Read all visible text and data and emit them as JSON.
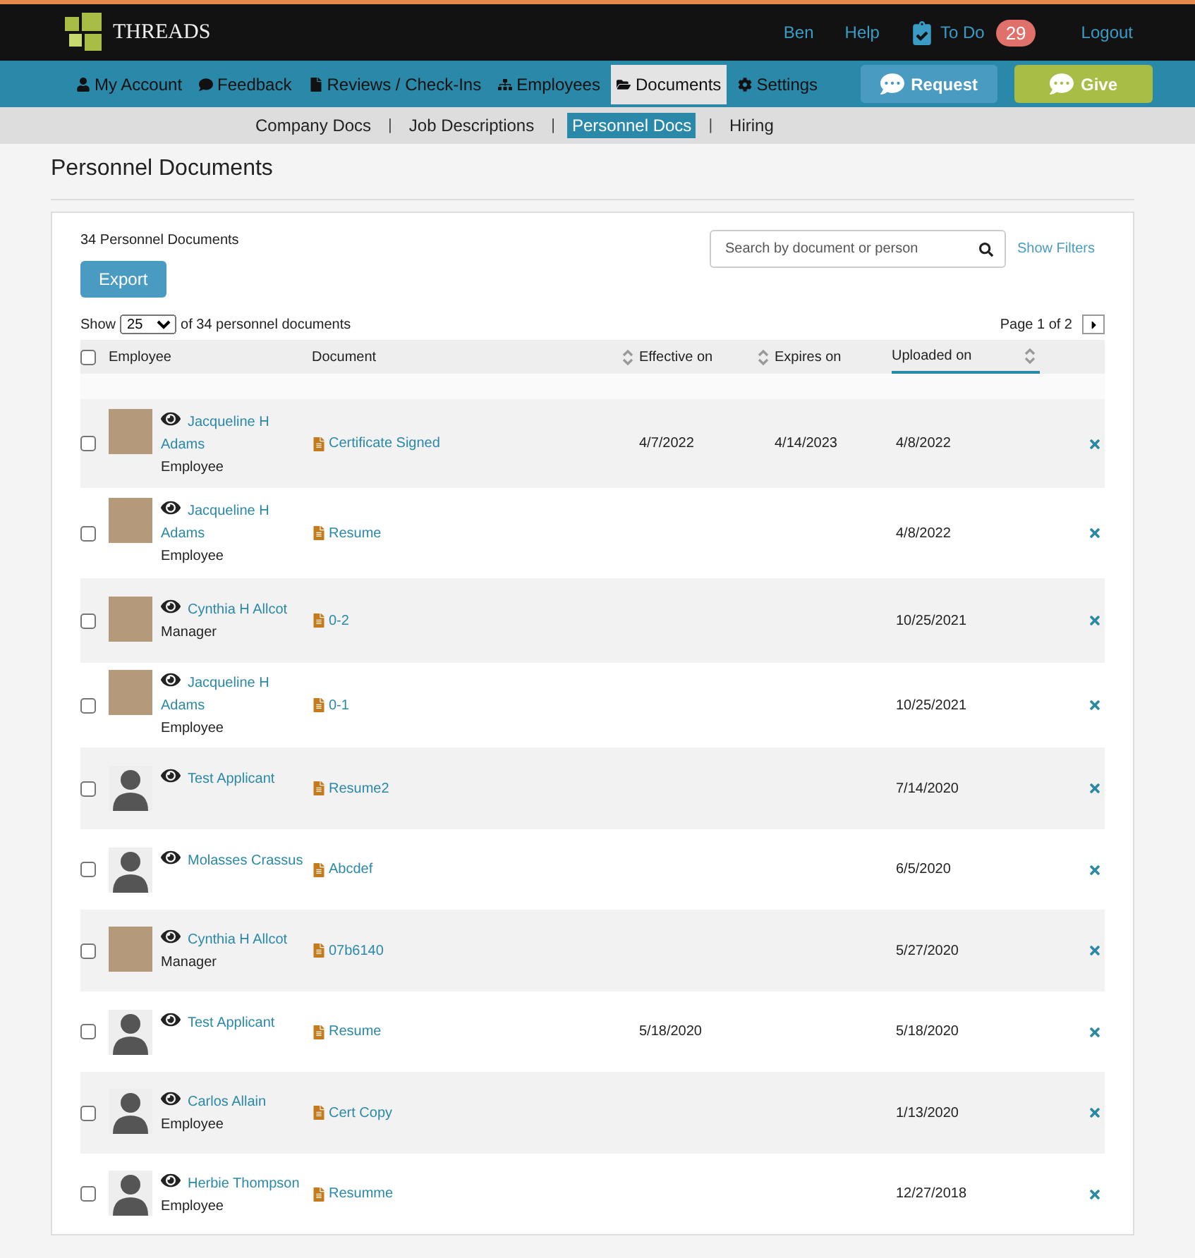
{
  "header": {
    "logo": "THREADS",
    "links": [
      {
        "label": "Ben"
      },
      {
        "label": "Help"
      }
    ],
    "todo": {
      "label": "To Do",
      "count": "29"
    },
    "logout": "Logout"
  },
  "nav": {
    "items": [
      {
        "label": "My Account",
        "kind": "user",
        "selected": false
      },
      {
        "label": "Feedback",
        "kind": "comment",
        "selected": false
      },
      {
        "label": "Reviews / Check-Ins",
        "kind": "file",
        "selected": false
      },
      {
        "label": "Employees",
        "kind": "sitemap",
        "selected": false
      },
      {
        "label": "Documents",
        "kind": "folder",
        "selected": true
      },
      {
        "label": "Settings",
        "kind": "gear",
        "selected": false
      }
    ],
    "buttons": [
      {
        "label": "Request",
        "kind": "request"
      },
      {
        "label": "Give",
        "kind": "give"
      }
    ]
  },
  "subnav": [
    {
      "label": "Company Docs",
      "selected": false
    },
    {
      "separator": "|",
      "label": "Job Descriptions",
      "selected": false
    },
    {
      "separator": "|",
      "label": "Personnel Docs",
      "selected": true
    },
    {
      "separator": "|",
      "label": "Hiring",
      "selected": false
    }
  ],
  "page_title": "Personnel Documents",
  "card": {
    "count": "34 Personnel Documents",
    "export": "Export",
    "search": {
      "placeholder": "Search by document or person"
    },
    "show_filters": "Show Filters",
    "show_label": "Show",
    "page_size": "25",
    "show_suffix": "of 34 personnel documents",
    "pagination": "Page 1 of 2"
  },
  "table": {
    "select_all": {
      "checked": false
    },
    "columns": [
      {
        "label": "Employee",
        "sortable": false,
        "selected": false
      },
      {
        "label": "Document",
        "sortable": false,
        "selected": false
      },
      {
        "label": "Effective on",
        "sortable": true,
        "selected": false
      },
      {
        "label": "Expires on",
        "sortable": true,
        "selected": false
      },
      {
        "label": "Uploaded on",
        "sortable": true,
        "selected": true
      }
    ],
    "rows": [
      {
        "checked": false,
        "kind": "photo",
        "name": "Jacqueline H Adams",
        "role": "Employee",
        "document": "Certificate Signed",
        "effective": "4/7/2022",
        "expires": "4/14/2023",
        "uploaded": "4/8/2022"
      },
      {
        "checked": false,
        "kind": "photo",
        "name": "Jacqueline H Adams",
        "role": "Employee",
        "document": "Resume",
        "uploaded": "4/8/2022"
      },
      {
        "checked": false,
        "kind": "photo",
        "name": "Cynthia H Allcot",
        "role": "Manager",
        "document": "0-2",
        "uploaded": "10/25/2021"
      },
      {
        "checked": false,
        "kind": "photo",
        "name": "Jacqueline H Adams",
        "role": "Employee",
        "document": "0-1",
        "uploaded": "10/25/2021"
      },
      {
        "checked": false,
        "kind": "silhouette",
        "name": "Test Applicant",
        "document": "Resume2",
        "uploaded": "7/14/2020"
      },
      {
        "checked": false,
        "kind": "silhouette",
        "name": "Molasses Crassus",
        "document": "Abcdef",
        "uploaded": "6/5/2020"
      },
      {
        "checked": false,
        "kind": "photo",
        "name": "Cynthia H Allcot",
        "role": "Manager",
        "document": "07b6140",
        "uploaded": "5/27/2020"
      },
      {
        "checked": false,
        "kind": "silhouette",
        "name": "Test Applicant",
        "document": "Resume",
        "effective": "5/18/2020",
        "uploaded": "5/18/2020"
      },
      {
        "checked": false,
        "kind": "silhouette",
        "name": "Carlos Allain",
        "role": "Employee",
        "document": "Cert Copy",
        "uploaded": "1/13/2020"
      },
      {
        "checked": false,
        "kind": "silhouette",
        "name": "Herbie Thompson",
        "role": "Employee",
        "document": "Resumme",
        "uploaded": "12/27/2018"
      }
    ]
  }
}
